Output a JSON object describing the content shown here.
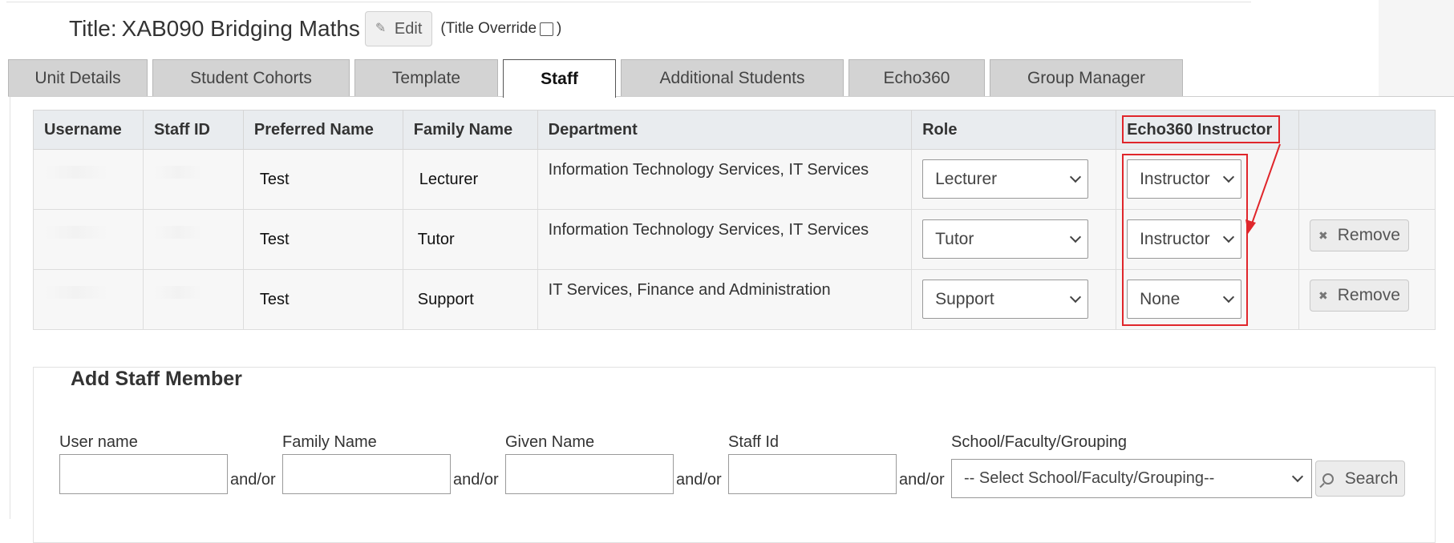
{
  "header": {
    "title_label": "Title:",
    "title_value": "XAB090 Bridging Maths",
    "edit_label": "Edit",
    "override_prefix": "(Title Override",
    "override_suffix": ")"
  },
  "tabs": [
    {
      "label": "Unit Details"
    },
    {
      "label": "Student Cohorts"
    },
    {
      "label": "Template"
    },
    {
      "label": "Staff",
      "active": true
    },
    {
      "label": "Additional Students"
    },
    {
      "label": "Echo360"
    },
    {
      "label": "Group Manager"
    }
  ],
  "staff_table": {
    "columns": [
      "Username",
      "Staff ID",
      "Preferred Name",
      "Family Name",
      "Department",
      "Role",
      "Echo360 Instructor",
      ""
    ],
    "rows": [
      {
        "preferred_name": "Test",
        "family_name": "Lecturer",
        "department": "Information Technology Services, IT Services",
        "role": "Lecturer",
        "echo360": "Instructor",
        "remove": ""
      },
      {
        "preferred_name": "Test",
        "family_name": "Tutor",
        "department": "Information Technology Services, IT Services",
        "role": "Tutor",
        "echo360": "Instructor",
        "remove": "Remove"
      },
      {
        "preferred_name": "Test",
        "family_name": "Support",
        "department": "IT Services, Finance and Administration",
        "role": "Support",
        "echo360": "None",
        "remove": "Remove"
      }
    ]
  },
  "add_staff": {
    "legend": "Add Staff Member",
    "fields": [
      {
        "label": "User name"
      },
      {
        "label": "Family Name"
      },
      {
        "label": "Given Name"
      },
      {
        "label": "Staff Id"
      }
    ],
    "andor": "and/or",
    "school_label": "School/Faculty/Grouping",
    "school_placeholder": "-- Select School/Faculty/Grouping--",
    "search_label": "Search"
  },
  "colors": {
    "highlight": "#e0262b",
    "tab_bg": "#d3d3d3",
    "header_bg": "#e9ecef"
  }
}
